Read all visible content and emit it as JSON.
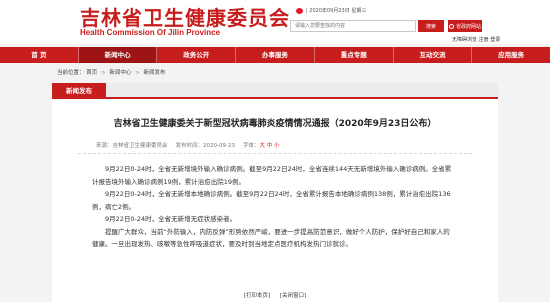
{
  "header": {
    "logo_cn": "吉林省卫生健康委员会",
    "logo_en": "Health Commission Of Jilin Province",
    "date_line": "| 2020年09月23日 星期三",
    "search_placeholder": "请输入您要查找的内容",
    "search_button": "搜索",
    "portal_button": "省政府网站",
    "user_register": "无障碍浏览",
    "user_login": "注册 登录"
  },
  "nav": {
    "items": [
      "首 页",
      "新闻中心",
      "政务公开",
      "办事服务",
      "重点专题",
      "互动交流",
      "应用服务"
    ],
    "active_index": 1
  },
  "breadcrumb": {
    "label": "当前位置：",
    "items": [
      "首页",
      "新闻中心",
      "新闻发布"
    ],
    "separator": ">"
  },
  "tab": {
    "label": "新闻发布"
  },
  "article": {
    "title": "吉林省卫生健康委关于新型冠状病毒肺炎疫情情况通报（2020年9月23日公布）",
    "source": "来源：吉林省卫生健康委员会",
    "date": "发布时间：2020-09-23",
    "size_label": "字体：",
    "size_options": "大 中 小",
    "paragraphs": [
      "9月22日0-24时，全省无新增境外输入确诊病例。截至9月22日24时，全省连续144天无新增境外输入确诊病例。全省累计报告境外输入确诊病例19例，累计治愈出院19例。",
      "9月22日0-24时，全省无新增本地确诊病例。截至9月22日24时，全省累计报告本地确诊病例138例，累计治愈出院136例，病亡2例。",
      "9月22日0-24时，全省无新增无症状感染者。",
      "提醒广大群众，当前“外防输入，内防反弹”形势依然严峻，要进一步提高防范意识，做好个人防护，保护好自己和家人的健康。一旦出现发热、咳嗽等急性呼吸道症状，要及时到当地定点医疗机构发热门诊就诊。"
    ],
    "print_label": "[打印本页]",
    "close_label": "[关闭窗口]"
  },
  "colors": {
    "brand_red": "#c81d1d",
    "nav_active": "#9e1414"
  }
}
